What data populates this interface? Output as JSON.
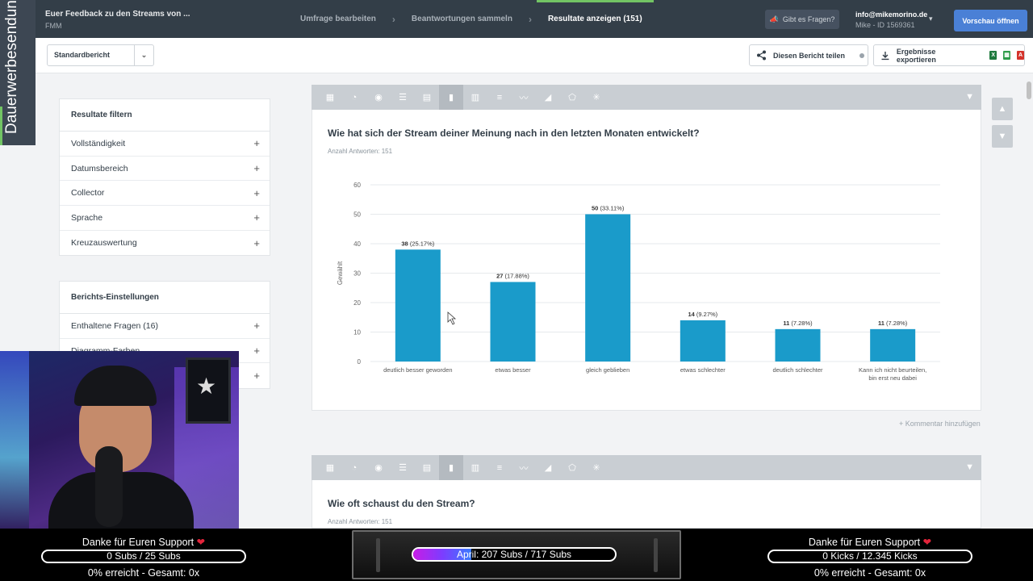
{
  "brand": {
    "text": "Dauerwerbesendung"
  },
  "header": {
    "survey_title": "Euer Feedback zu den Streams von ...",
    "survey_sub": "FMM",
    "steps": [
      "Umfrage bearbeiten",
      "Beantwortungen sammeln",
      "Resultate anzeigen (151)"
    ],
    "help_label": "Gibt es Fragen?",
    "account_email": "info@mikemorino.de",
    "account_id": "Mike  -  ID 1569361",
    "preview_label": "Vorschau öffnen"
  },
  "toolbar": {
    "report_select": "Standardbericht",
    "share_label": "Diesen Bericht teilen",
    "export_label": "Ergebnisse exportieren"
  },
  "filter_panel": {
    "title": "Resultate filtern",
    "items": [
      "Vollständigkeit",
      "Datumsbereich",
      "Collector",
      "Sprache",
      "Kreuzauswertung"
    ]
  },
  "settings_panel": {
    "title": "Berichts-Einstellungen",
    "items": [
      "Enthaltene Fragen (16)",
      "Diagramm-Farben",
      ""
    ]
  },
  "question1": {
    "title": "Wie hat sich der Stream deiner Meinung nach in den letzten Monaten entwickelt?",
    "count": "Anzahl Antworten: 151",
    "comment_link": "+ Kommentar hinzufügen"
  },
  "question2": {
    "title": "Wie oft schaust du den Stream?",
    "count": "Anzahl Antworten: 151"
  },
  "chart_data": {
    "type": "bar",
    "ylabel": "Gewählt",
    "ylim": [
      0,
      60
    ],
    "yticks": [
      0,
      10,
      20,
      30,
      40,
      50,
      60
    ],
    "categories": [
      "deutlich besser geworden",
      "etwas besser",
      "gleich geblieben",
      "etwas schlechter",
      "deutlich schlechter",
      "Kann ich nicht beurteilen, bin erst neu dabei"
    ],
    "values": [
      38,
      27,
      50,
      14,
      11,
      11
    ],
    "value_labels": [
      "38",
      "27",
      "50",
      "14",
      "11",
      "11"
    ],
    "percent_labels": [
      "(25.17%)",
      "(17.88%)",
      "(33.11%)",
      "(9.27%)",
      "(7.28%)",
      "(7.28%)"
    ],
    "bar_color": "#1a9bca",
    "grid": true
  },
  "overlay": {
    "left": {
      "title": "Danke für Euren Support",
      "bar": "0 Subs / 25 Subs",
      "footer": "0% erreicht - Gesamt: 0x",
      "progress": 0
    },
    "center": {
      "bar": "April: 207 Subs / 717 Subs",
      "progress": 0.289
    },
    "right": {
      "title": "Danke für Euren Support",
      "bar": "0 Kicks / 12.345 Kicks",
      "footer": "0% erreicht - Gesamt: 0x",
      "progress": 0
    }
  },
  "colors": {
    "accent": "#4a80d6",
    "nav_active": "#72c464",
    "topbar": "#333e48"
  }
}
